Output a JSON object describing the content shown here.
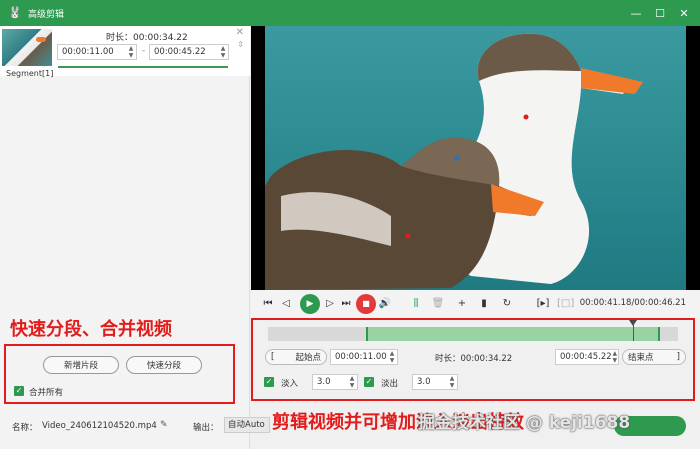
{
  "window": {
    "title": "高级剪辑",
    "icons": {
      "app": "rabbit-icon",
      "minimize": "minimize-icon",
      "maximize": "maximize-icon",
      "close": "close-icon"
    }
  },
  "segment": {
    "label": "Segment[1]",
    "duration_label": "时长：00:00:34.22",
    "start": "00:00:11.00",
    "separator": "-",
    "end": "00:00:45.22"
  },
  "annotations": {
    "left": "快速分段、合并视频",
    "right": "剪辑视频并可增加淡入淡出特效",
    "watermark": "掘金技术社区 @ keji1688"
  },
  "left_actions": {
    "new_segment": "新增片段",
    "fast_split": "快速分段",
    "merge_all": "合并所有"
  },
  "footer": {
    "name_label": "名称：",
    "name_value": "Video_240612104520.mp4",
    "output_label": "输出：",
    "output_value": "自动Auto"
  },
  "player": {
    "timecode": "00:00:41.18/00:00:46.21",
    "icons": [
      "skip-start-icon",
      "frame-back-icon",
      "play-icon",
      "frame-forward-icon",
      "skip-end-icon",
      "stop-icon",
      "volume-icon",
      "split-icon",
      "delete-icon",
      "add-icon",
      "copy-icon",
      "reset-icon",
      "crop-in-icon",
      "crop-out-icon"
    ]
  },
  "trim": {
    "start_point_label": "起始点",
    "start_value": "00:00:11.00",
    "duration_label": "时长：00:00:34.22",
    "end_value": "00:00:45.22",
    "end_point_label": "结束点",
    "selection_start_fraction": 0.238,
    "selection_end_fraction": 0.955,
    "playhead_fraction": 0.891
  },
  "fade": {
    "fade_in_label": "淡入",
    "fade_in_value": "3.0",
    "fade_out_label": "淡出",
    "fade_out_value": "3.0"
  },
  "colors": {
    "accent": "#2e9a4f",
    "annotation": "#e21c1c",
    "stop": "#e23a3a"
  }
}
